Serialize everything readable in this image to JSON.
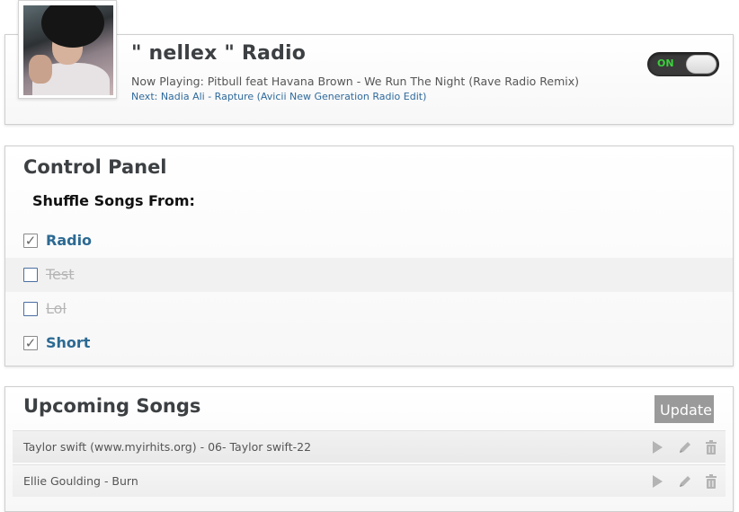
{
  "radio": {
    "title": "\" nellex \" Radio",
    "now_playing": "Now Playing: Pitbull feat Havana Brown - We Run The Night (Rave Radio Remix)",
    "next": "Next: Nadia Ali - Rapture (Avicii New Generation Radio Edit)",
    "toggle_label": "ON",
    "toggle_on": true
  },
  "control_panel": {
    "title": "Control Panel",
    "shuffle_label": "Shuffle Songs From:",
    "playlists": [
      {
        "label": "Radio",
        "checked": true
      },
      {
        "label": "Test",
        "checked": false
      },
      {
        "label": "Lol",
        "checked": false
      },
      {
        "label": "Short",
        "checked": true
      }
    ]
  },
  "upcoming": {
    "title": "Upcoming Songs",
    "update_label": "Update",
    "songs": [
      {
        "title": "Taylor swift (www.myirhits.org) - 06- Taylor swift-22"
      },
      {
        "title": "Ellie Goulding - Burn"
      }
    ]
  },
  "colors": {
    "link": "#2f6a9c",
    "toggle_on_text": "#3ad13a",
    "active_playlist": "#2c6a93"
  },
  "icons": [
    "play-icon",
    "edit-icon",
    "trash-icon",
    "checkmark-icon"
  ]
}
